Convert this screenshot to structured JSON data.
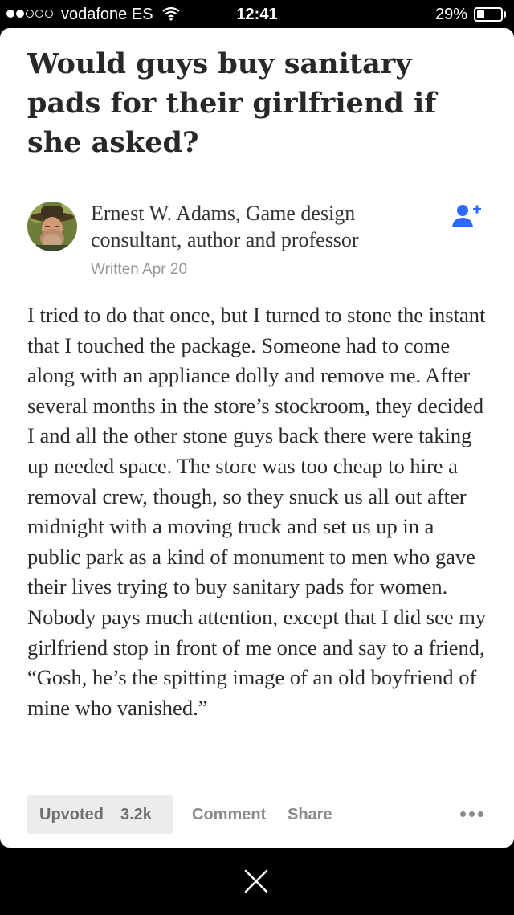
{
  "status_bar": {
    "carrier": "vodafone ES",
    "time": "12:41",
    "battery_percent": "29%"
  },
  "question": {
    "title": "Would guys buy sanitary pads for their girlfriend if she asked?"
  },
  "answer": {
    "author": "Ernest W. Adams, Game design consultant, author and professor",
    "written": "Written Apr 20",
    "text": "I tried to do that once, but I turned to stone the instant that I touched the package. Someone had to come along with an appliance dolly and remove me. After several months in the store’s stockroom, they decided I and all the other stone guys back there were taking up needed space. The store was too cheap to hire a removal crew, though, so they snuck us all out after midnight with a moving truck and set us up in a public park as a kind of monument to men who gave their lives trying to buy sanitary pads for women. Nobody pays much attention, except that I did see my girlfriend stop in front of me once and say to a friend, “Gosh, he’s the spitting image of an old boyfriend of mine who vanished.”"
  },
  "actions": {
    "upvote_label": "Upvoted",
    "upvote_count": "3.2k",
    "comment_label": "Comment",
    "share_label": "Share"
  },
  "icons": {
    "follow": "add-user-icon",
    "more": "more-icon",
    "close": "close-icon",
    "wifi": "wifi-icon",
    "battery": "battery-icon"
  },
  "colors": {
    "accent_blue": "#2e69ff",
    "title_text": "#282829",
    "meta_gray": "#999999"
  }
}
